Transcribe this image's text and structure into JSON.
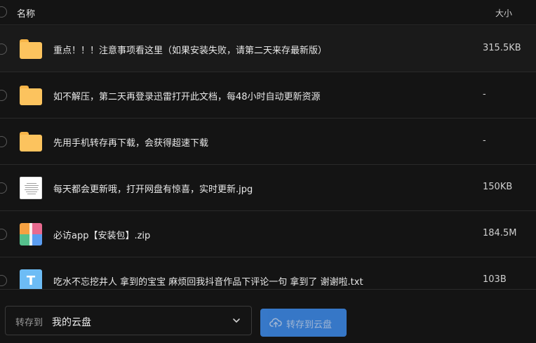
{
  "header": {
    "name_col": "名称",
    "size_col": "大小"
  },
  "files": [
    {
      "name": "重点！！！注意事项看这里（如果安装失败，请第二天来存最新版）",
      "size": "315.5KB",
      "icon": "folder-icon"
    },
    {
      "name": "如不解压，第二天再登录迅雷打开此文档，每48小时自动更新资源",
      "size": "-",
      "icon": "folder-icon"
    },
    {
      "name": "先用手机转存再下载，会获得超速下载",
      "size": "-",
      "icon": "folder-icon"
    },
    {
      "name": "每天都会更新哦，打开网盘有惊喜，实时更新.jpg",
      "size": "150KB",
      "icon": "image-file-icon"
    },
    {
      "name": "必访app【安装包】.zip",
      "size": "184.5M",
      "icon": "zip-file-icon"
    },
    {
      "name": "吃水不忘挖井人 拿到的宝宝 麻烦回我抖音作品下评论一句 拿到了 谢谢啦.txt",
      "size": "103B",
      "icon": "txt-file-icon",
      "icon_letter": "T"
    }
  ],
  "footer": {
    "dest_label": "转存到",
    "dest_value": "我的云盘",
    "save_button": "转存到云盘"
  },
  "colors": {
    "background": "#141414",
    "folder": "#fcc35e",
    "accent": "#3d89e7",
    "txt_icon": "#6dbcf5"
  }
}
